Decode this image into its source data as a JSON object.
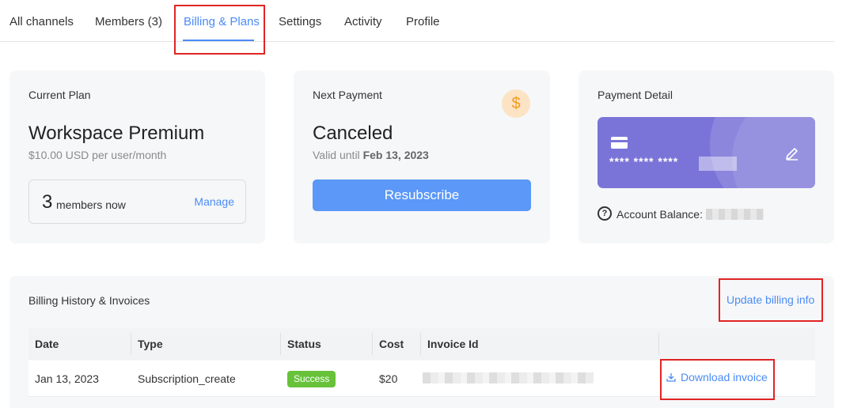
{
  "tabs": [
    {
      "label": "All channels"
    },
    {
      "label": "Members (3)"
    },
    {
      "label": "Billing & Plans"
    },
    {
      "label": "Settings"
    },
    {
      "label": "Activity"
    },
    {
      "label": "Profile"
    }
  ],
  "active_tab": "Billing & Plans",
  "current_plan": {
    "title": "Current Plan",
    "plan_name": "Workspace Premium",
    "price": "$10.00 USD per user/month",
    "members_count": "3",
    "members_text": "members now",
    "manage_label": "Manage"
  },
  "next_payment": {
    "title": "Next Payment",
    "status": "Canceled",
    "valid_until_prefix": "Valid until ",
    "valid_until_date": "Feb 13, 2023",
    "icon": "dollar-icon",
    "icon_glyph": "$",
    "resubscribe_label": "Resubscribe"
  },
  "payment_detail": {
    "title": "Payment Detail",
    "masked_card": "**** **** ****",
    "balance_label": "Account Balance:"
  },
  "billing_history": {
    "title": "Billing History & Invoices",
    "update_label": "Update billing info",
    "columns": [
      "Date",
      "Type",
      "Status",
      "Cost",
      "Invoice Id"
    ],
    "rows": [
      {
        "date": "Jan 13, 2023",
        "type": "Subscription_create",
        "status": "Success",
        "cost": "$20",
        "download_label": "Download invoice"
      }
    ]
  },
  "colors": {
    "accent": "#4a8cf7",
    "highlight_box": "#e02424",
    "success": "#67c23a",
    "card_purple": "#7b74d8"
  }
}
